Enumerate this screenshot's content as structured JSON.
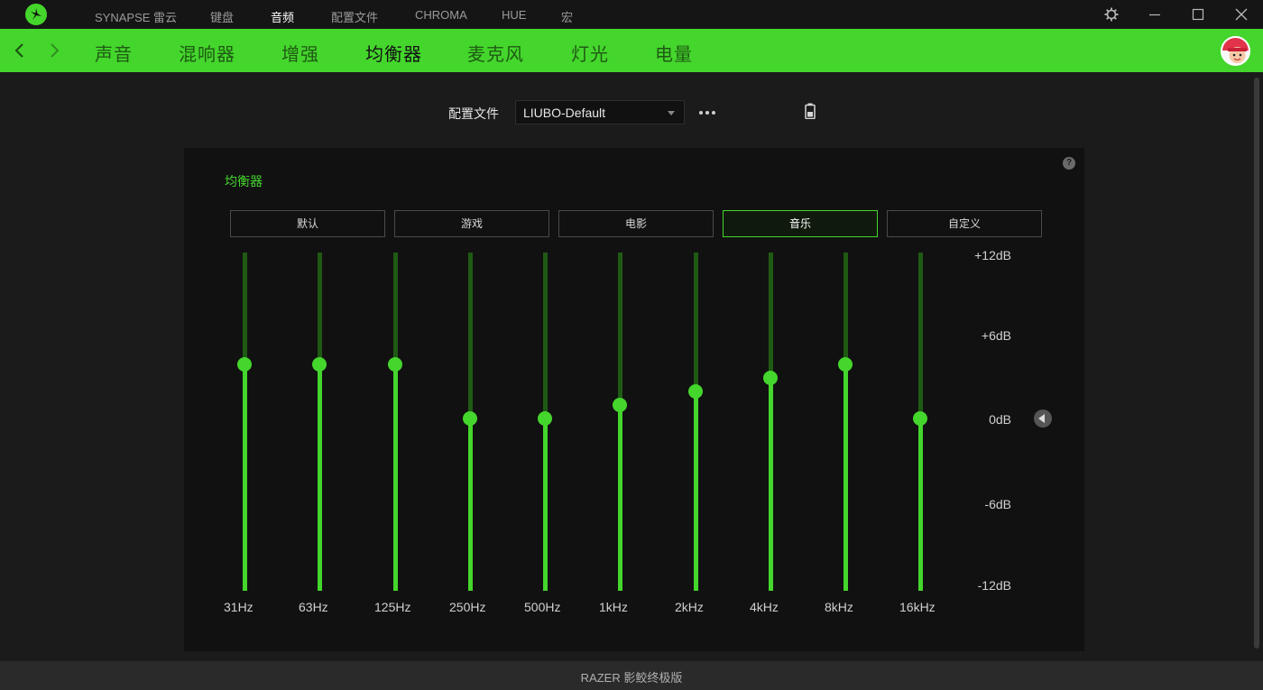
{
  "titlebar": {
    "nav": [
      {
        "label": "SYNAPSE 雷云",
        "active": false
      },
      {
        "label": "键盘",
        "active": false
      },
      {
        "label": "音频",
        "active": true
      },
      {
        "label": "配置文件",
        "active": false
      },
      {
        "label": "CHROMA",
        "active": false
      },
      {
        "label": "HUE",
        "active": false
      },
      {
        "label": "宏",
        "active": false
      }
    ]
  },
  "subnav": {
    "tabs": [
      {
        "label": "声音",
        "active": false
      },
      {
        "label": "混响器",
        "active": false
      },
      {
        "label": "增强",
        "active": false
      },
      {
        "label": "均衡器",
        "active": true
      },
      {
        "label": "麦克风",
        "active": false
      },
      {
        "label": "灯光",
        "active": false
      },
      {
        "label": "电量",
        "active": false
      }
    ]
  },
  "profile": {
    "label": "配置文件",
    "selected": "LIUBO-Default"
  },
  "equalizer": {
    "title": "均衡器",
    "help": "?",
    "presets": [
      {
        "label": "默认",
        "active": false
      },
      {
        "label": "游戏",
        "active": false
      },
      {
        "label": "电影",
        "active": false
      },
      {
        "label": "音乐",
        "active": true
      },
      {
        "label": "自定义",
        "active": false
      }
    ],
    "range_db": [
      -12,
      12
    ],
    "scale_labels": [
      "+12dB",
      "+6dB",
      "0dB",
      "-6dB",
      "-12dB"
    ],
    "bands": [
      {
        "freq": "31Hz",
        "gain_db": 4
      },
      {
        "freq": "63Hz",
        "gain_db": 4
      },
      {
        "freq": "125Hz",
        "gain_db": 4
      },
      {
        "freq": "250Hz",
        "gain_db": 0
      },
      {
        "freq": "500Hz",
        "gain_db": 0
      },
      {
        "freq": "1kHz",
        "gain_db": 1
      },
      {
        "freq": "2kHz",
        "gain_db": 2
      },
      {
        "freq": "4kHz",
        "gain_db": 3
      },
      {
        "freq": "8kHz",
        "gain_db": 4
      },
      {
        "freq": "16kHz",
        "gain_db": 0
      }
    ]
  },
  "footer": {
    "device": "RAZER 影鲛终极版"
  },
  "colors": {
    "accent": "#44d62c",
    "panel": "#111111",
    "background": "#1b1b1b"
  }
}
